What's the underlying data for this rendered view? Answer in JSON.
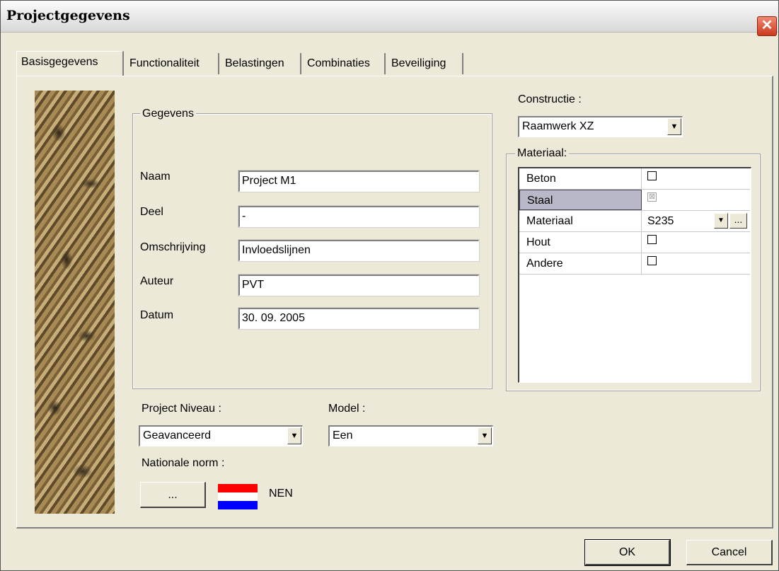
{
  "window": {
    "title": "Projectgegevens",
    "close_glyph": "✕"
  },
  "tabs": [
    {
      "label": "Basisgegevens",
      "active": true
    },
    {
      "label": "Functionaliteit",
      "active": false
    },
    {
      "label": "Belastingen",
      "active": false
    },
    {
      "label": "Combinaties",
      "active": false
    },
    {
      "label": "Beveiliging",
      "active": false
    }
  ],
  "gegevens": {
    "legend": "Gegevens",
    "fields": [
      {
        "label": "Naam",
        "value": "Project M1"
      },
      {
        "label": "Deel",
        "value": "-"
      },
      {
        "label": "Omschrijving",
        "value": "Invloedslijnen"
      },
      {
        "label": "Auteur",
        "value": "PVT"
      },
      {
        "label": "Datum",
        "value": "30. 09. 2005"
      }
    ]
  },
  "project_niveau": {
    "label": "Project Niveau :",
    "value": "Geavanceerd"
  },
  "model": {
    "label": "Model :",
    "value": "Een"
  },
  "nationale_norm": {
    "label": "Nationale norm :",
    "button_label": "...",
    "code": "NEN",
    "flag_colors": [
      "#ff0000",
      "#ffffff",
      "#0000ff"
    ]
  },
  "constructie": {
    "label": "Constructie :",
    "value": "Raamwerk XZ"
  },
  "materiaal": {
    "legend": "Materiaal:",
    "rows": [
      {
        "name": "Beton",
        "type": "checkbox",
        "checked": false
      },
      {
        "name": "Staal",
        "type": "checkbox",
        "checked": true,
        "selected": true,
        "mark": "⊠"
      },
      {
        "name": "Materiaal",
        "type": "select",
        "value": "S235",
        "more": "..."
      },
      {
        "name": "Hout",
        "type": "checkbox",
        "checked": false
      },
      {
        "name": "Andere",
        "type": "checkbox",
        "checked": false
      }
    ]
  },
  "buttons": {
    "ok": "OK",
    "cancel": "Cancel"
  },
  "arrow_glyph": "▼"
}
